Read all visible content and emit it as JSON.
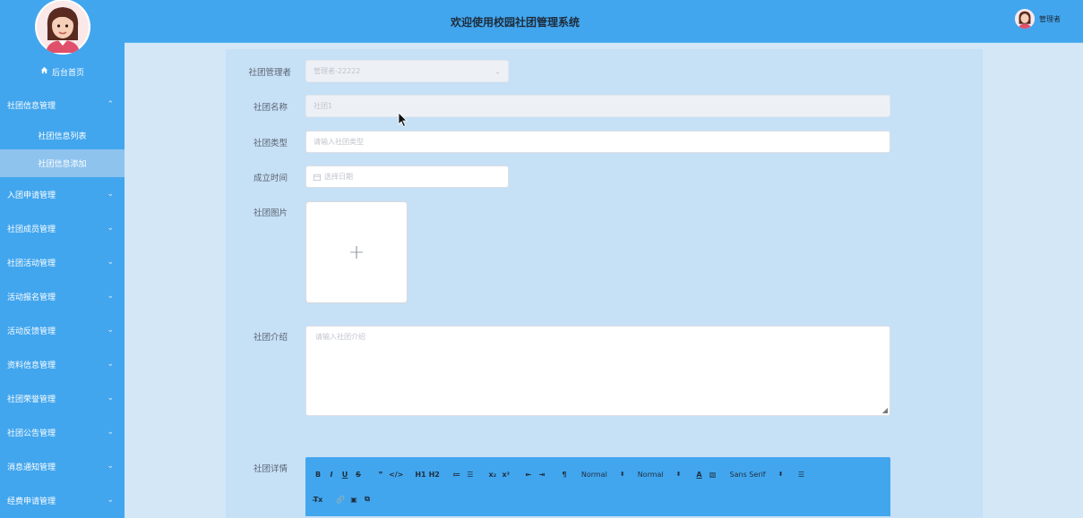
{
  "sidebar": {
    "home": "后台首页",
    "menus": [
      {
        "label": "社团信息管理",
        "expanded": true,
        "children": [
          {
            "label": "社团信息列表",
            "active": false
          },
          {
            "label": "社团信息添加",
            "active": true
          }
        ]
      },
      {
        "label": "入团申请管理"
      },
      {
        "label": "社团成员管理"
      },
      {
        "label": "社团活动管理"
      },
      {
        "label": "活动报名管理"
      },
      {
        "label": "活动反馈管理"
      },
      {
        "label": "资料信息管理"
      },
      {
        "label": "社团荣誉管理"
      },
      {
        "label": "社团公告管理"
      },
      {
        "label": "消息通知管理"
      },
      {
        "label": "经费申请管理"
      }
    ]
  },
  "header": {
    "title": "欢迎使用校园社团管理系统",
    "user": "管理者"
  },
  "form": {
    "manager_label": "社团管理者",
    "manager_value": "管理者-22222",
    "name_label": "社团名称",
    "name_value": "社团1",
    "type_label": "社团类型",
    "type_placeholder": "请输入社团类型",
    "date_label": "成立时间",
    "date_placeholder": "选择日期",
    "image_label": "社团图片",
    "upload_plus": "+",
    "intro_label": "社团介绍",
    "intro_placeholder": "请输入社团介绍",
    "detail_label": "社团详情"
  },
  "editor_toolbar": {
    "row1": [
      "B",
      "I",
      "U",
      "S",
      "❞",
      "</>",
      "H1",
      "H2",
      "≔",
      "☰",
      "x₂",
      "x²",
      "⇤",
      "⇥",
      "¶"
    ],
    "header_select": "Normal",
    "size_select": "Normal",
    "font_select": "Sans Serif",
    "row2": [
      "T̶x",
      "🔗",
      "▣",
      "⧉"
    ]
  },
  "colors": {
    "accent": "#42a6ee",
    "active_menu": "#8ec3ee",
    "panel": "#c6e0f6",
    "page_bg": "#d3e7f7"
  }
}
